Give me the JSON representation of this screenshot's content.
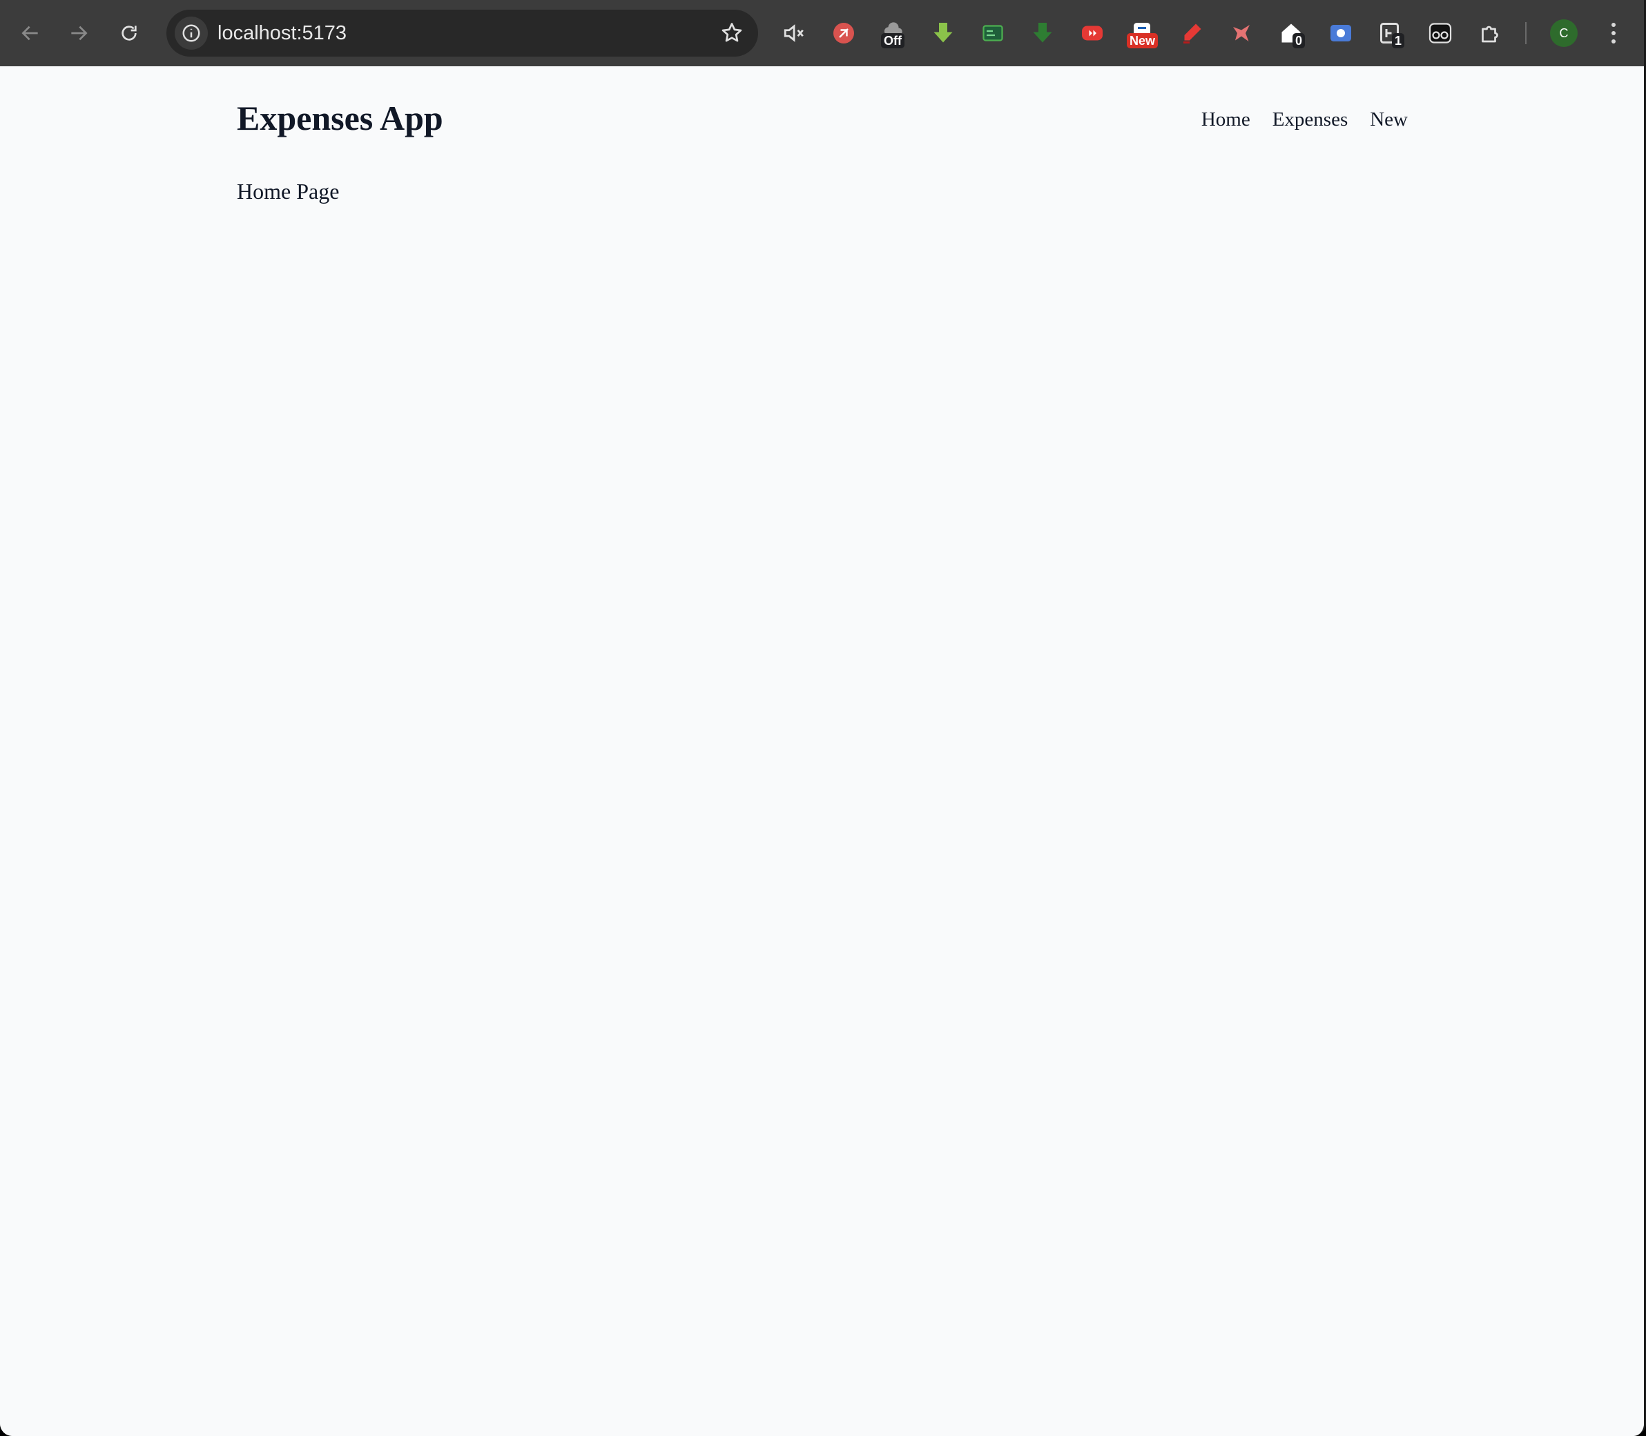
{
  "browser": {
    "url": "localhost:5173",
    "extensions": [
      {
        "icon": "mute-icon",
        "badge": ""
      },
      {
        "icon": "red-circle-extension-icon",
        "badge": ""
      },
      {
        "icon": "cloud-off-extension-icon",
        "badge": "Off"
      },
      {
        "icon": "green-down-arrow-extension-icon",
        "badge": ""
      },
      {
        "icon": "green-card-extension-icon",
        "badge": ""
      },
      {
        "icon": "dark-green-down-arrow-extension-icon",
        "badge": ""
      },
      {
        "icon": "red-play-extension-icon",
        "badge": ""
      },
      {
        "icon": "new-badge-extension-icon",
        "badge": "New"
      },
      {
        "icon": "red-marker-extension-icon",
        "badge": ""
      },
      {
        "icon": "red-bird-extension-icon",
        "badge": ""
      },
      {
        "icon": "house-extension-icon",
        "badge": "0"
      },
      {
        "icon": "blue-screen-extension-icon",
        "badge": ""
      },
      {
        "icon": "h-extension-icon",
        "badge": "1"
      },
      {
        "icon": "eyes-extension-icon",
        "badge": ""
      },
      {
        "icon": "puzzle-icon",
        "badge": ""
      }
    ],
    "profile_initial": "C",
    "colors": {
      "toolbar": "#3c3c3c",
      "omnibox": "#282828",
      "page_background": "#f9fafb",
      "text": "#111827"
    }
  },
  "header": {
    "title": "Expenses App",
    "nav": [
      "Home",
      "Expenses",
      "New"
    ]
  },
  "main": {
    "text": "Home Page"
  }
}
